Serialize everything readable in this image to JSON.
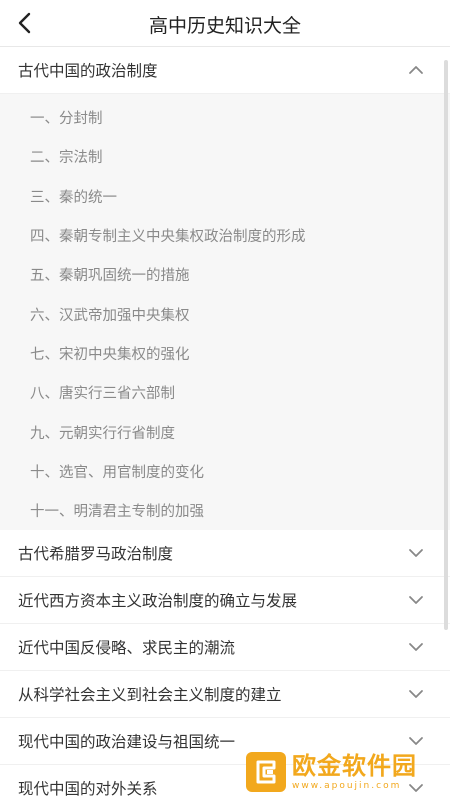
{
  "header": {
    "title": "高中历史知识大全"
  },
  "sections": [
    {
      "label": "古代中国的政治制度",
      "expanded": true
    },
    {
      "label": "古代希腊罗马政治制度",
      "expanded": false
    },
    {
      "label": "近代西方资本主义政治制度的确立与发展",
      "expanded": false
    },
    {
      "label": "近代中国反侵略、求民主的潮流",
      "expanded": false
    },
    {
      "label": "从科学社会主义到社会主义制度的建立",
      "expanded": false
    },
    {
      "label": "现代中国的政治建设与祖国统一",
      "expanded": false
    },
    {
      "label": "现代中国的对外关系",
      "expanded": false
    }
  ],
  "subitems": [
    "一、分封制",
    "二、宗法制",
    "三、秦的统一",
    "四、秦朝专制主义中央集权政治制度的形成",
    "五、秦朝巩固统一的措施",
    "六、汉武帝加强中央集权",
    "七、宋初中央集权的强化",
    "八、唐实行三省六部制",
    "九、元朝实行行省制度",
    "十、选官、用官制度的变化",
    "十一、明清君主专制的加强"
  ],
  "watermark": {
    "name": "欧金软件园",
    "url": "www.apoujin.com"
  },
  "colors": {
    "accent": "#f2a81d",
    "text": "#333333",
    "subtext": "#8a8a8a",
    "subbg": "#f7f7f7"
  }
}
